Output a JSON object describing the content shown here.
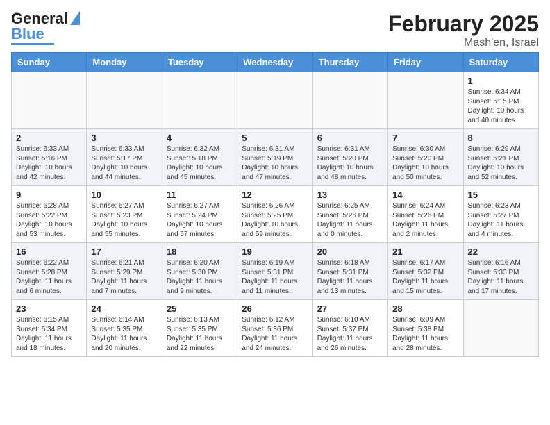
{
  "header": {
    "logo_line1": "General",
    "logo_line2": "Blue",
    "title": "February 2025",
    "subtitle": "Mash'en, Israel"
  },
  "weekdays": [
    "Sunday",
    "Monday",
    "Tuesday",
    "Wednesday",
    "Thursday",
    "Friday",
    "Saturday"
  ],
  "weeks": [
    {
      "alt": false,
      "days": [
        {
          "num": "",
          "info": ""
        },
        {
          "num": "",
          "info": ""
        },
        {
          "num": "",
          "info": ""
        },
        {
          "num": "",
          "info": ""
        },
        {
          "num": "",
          "info": ""
        },
        {
          "num": "",
          "info": ""
        },
        {
          "num": "1",
          "info": "Sunrise: 6:34 AM\nSunset: 5:15 PM\nDaylight: 10 hours\nand 40 minutes."
        }
      ]
    },
    {
      "alt": true,
      "days": [
        {
          "num": "2",
          "info": "Sunrise: 6:33 AM\nSunset: 5:16 PM\nDaylight: 10 hours\nand 42 minutes."
        },
        {
          "num": "3",
          "info": "Sunrise: 6:33 AM\nSunset: 5:17 PM\nDaylight: 10 hours\nand 44 minutes."
        },
        {
          "num": "4",
          "info": "Sunrise: 6:32 AM\nSunset: 5:18 PM\nDaylight: 10 hours\nand 45 minutes."
        },
        {
          "num": "5",
          "info": "Sunrise: 6:31 AM\nSunset: 5:19 PM\nDaylight: 10 hours\nand 47 minutes."
        },
        {
          "num": "6",
          "info": "Sunrise: 6:31 AM\nSunset: 5:20 PM\nDaylight: 10 hours\nand 48 minutes."
        },
        {
          "num": "7",
          "info": "Sunrise: 6:30 AM\nSunset: 5:20 PM\nDaylight: 10 hours\nand 50 minutes."
        },
        {
          "num": "8",
          "info": "Sunrise: 6:29 AM\nSunset: 5:21 PM\nDaylight: 10 hours\nand 52 minutes."
        }
      ]
    },
    {
      "alt": false,
      "days": [
        {
          "num": "9",
          "info": "Sunrise: 6:28 AM\nSunset: 5:22 PM\nDaylight: 10 hours\nand 53 minutes."
        },
        {
          "num": "10",
          "info": "Sunrise: 6:27 AM\nSunset: 5:23 PM\nDaylight: 10 hours\nand 55 minutes."
        },
        {
          "num": "11",
          "info": "Sunrise: 6:27 AM\nSunset: 5:24 PM\nDaylight: 10 hours\nand 57 minutes."
        },
        {
          "num": "12",
          "info": "Sunrise: 6:26 AM\nSunset: 5:25 PM\nDaylight: 10 hours\nand 59 minutes."
        },
        {
          "num": "13",
          "info": "Sunrise: 6:25 AM\nSunset: 5:26 PM\nDaylight: 11 hours\nand 0 minutes."
        },
        {
          "num": "14",
          "info": "Sunrise: 6:24 AM\nSunset: 5:26 PM\nDaylight: 11 hours\nand 2 minutes."
        },
        {
          "num": "15",
          "info": "Sunrise: 6:23 AM\nSunset: 5:27 PM\nDaylight: 11 hours\nand 4 minutes."
        }
      ]
    },
    {
      "alt": true,
      "days": [
        {
          "num": "16",
          "info": "Sunrise: 6:22 AM\nSunset: 5:28 PM\nDaylight: 11 hours\nand 6 minutes."
        },
        {
          "num": "17",
          "info": "Sunrise: 6:21 AM\nSunset: 5:29 PM\nDaylight: 11 hours\nand 7 minutes."
        },
        {
          "num": "18",
          "info": "Sunrise: 6:20 AM\nSunset: 5:30 PM\nDaylight: 11 hours\nand 9 minutes."
        },
        {
          "num": "19",
          "info": "Sunrise: 6:19 AM\nSunset: 5:31 PM\nDaylight: 11 hours\nand 11 minutes."
        },
        {
          "num": "20",
          "info": "Sunrise: 6:18 AM\nSunset: 5:31 PM\nDaylight: 11 hours\nand 13 minutes."
        },
        {
          "num": "21",
          "info": "Sunrise: 6:17 AM\nSunset: 5:32 PM\nDaylight: 11 hours\nand 15 minutes."
        },
        {
          "num": "22",
          "info": "Sunrise: 6:16 AM\nSunset: 5:33 PM\nDaylight: 11 hours\nand 17 minutes."
        }
      ]
    },
    {
      "alt": false,
      "days": [
        {
          "num": "23",
          "info": "Sunrise: 6:15 AM\nSunset: 5:34 PM\nDaylight: 11 hours\nand 18 minutes."
        },
        {
          "num": "24",
          "info": "Sunrise: 6:14 AM\nSunset: 5:35 PM\nDaylight: 11 hours\nand 20 minutes."
        },
        {
          "num": "25",
          "info": "Sunrise: 6:13 AM\nSunset: 5:35 PM\nDaylight: 11 hours\nand 22 minutes."
        },
        {
          "num": "26",
          "info": "Sunrise: 6:12 AM\nSunset: 5:36 PM\nDaylight: 11 hours\nand 24 minutes."
        },
        {
          "num": "27",
          "info": "Sunrise: 6:10 AM\nSunset: 5:37 PM\nDaylight: 11 hours\nand 26 minutes."
        },
        {
          "num": "28",
          "info": "Sunrise: 6:09 AM\nSunset: 5:38 PM\nDaylight: 11 hours\nand 28 minutes."
        },
        {
          "num": "",
          "info": ""
        }
      ]
    }
  ]
}
